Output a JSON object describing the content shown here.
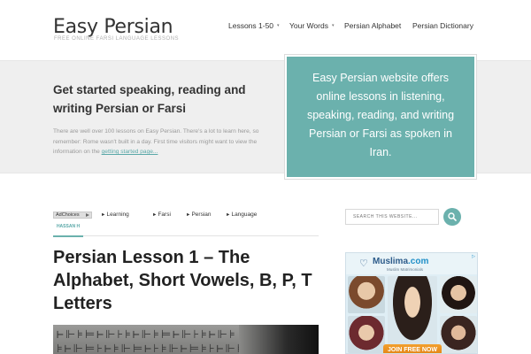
{
  "site": {
    "title": "Easy Persian",
    "tagline": "FREE ONLINE FARSI LANGUAGE LESSONS"
  },
  "nav": {
    "items": [
      {
        "label": "Lessons 1-50",
        "has_dropdown": true
      },
      {
        "label": "Your Words",
        "has_dropdown": true
      },
      {
        "label": "Persian Alphabet",
        "has_dropdown": false
      },
      {
        "label": "Persian Dictionary",
        "has_dropdown": false
      }
    ],
    "caret": "▾"
  },
  "hero": {
    "heading": "Get started speaking, reading and writing Persian or Farsi",
    "text_before_link": "There are well over 100 lessons on Easy Persian. There's a lot to learn here, so remember: Rome wasn't built in a day. First time visitors might want to view the information on the ",
    "link_text": "getting started page...",
    "promo": "Easy Persian website offers online lessons in listening, speaking, reading, and writing Persian or Farsi as spoken in Iran."
  },
  "ad_links": {
    "adchoices": "AdChoices",
    "arrow": "►",
    "items": [
      "Learning",
      "Farsi",
      "Persian",
      "Language"
    ]
  },
  "author_tab": "HASSAN H",
  "post": {
    "title": "Persian Lesson 1 – The Alphabet, Short Vowels, B, P, T Letters"
  },
  "sidebar": {
    "search_placeholder": "SEARCH THIS WEBSITE...",
    "ad": {
      "logo_text": "Muslima",
      "logo_suffix": ".com",
      "subtitle": "Muslim Matrimonials",
      "cta": "JOIN FREE NOW"
    }
  },
  "colors": {
    "accent": "#6bb1ad",
    "link": "#5aa8a8",
    "cta": "#e88d1c"
  }
}
